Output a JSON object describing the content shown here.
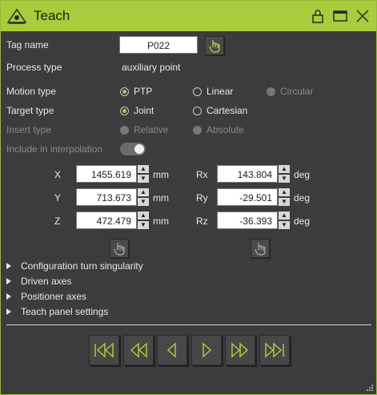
{
  "window": {
    "title": "Teach"
  },
  "fields": {
    "tag_name_label": "Tag name",
    "tag_name_value": "P022",
    "process_type_label": "Process type",
    "process_type_value": "auxiliary point",
    "motion_type_label": "Motion type",
    "motion_options": [
      "PTP",
      "Linear",
      "Circular"
    ],
    "motion_selected": "PTP",
    "target_type_label": "Target type",
    "target_options": [
      "Joint",
      "Cartesian"
    ],
    "target_selected": "Joint",
    "insert_type_label": "Insert type",
    "insert_options": [
      "Relative",
      "Absolute"
    ],
    "insert_selected": "Relative",
    "include_interp_label": "Include in interpolation",
    "include_interp_on": true
  },
  "coords": {
    "x_label": "X",
    "x_value": "1455.619",
    "x_unit": "mm",
    "y_label": "Y",
    "y_value": "713.673",
    "y_unit": "mm",
    "z_label": "Z",
    "z_value": "472.479",
    "z_unit": "mm",
    "rx_label": "Rx",
    "rx_value": "143.804",
    "rx_unit": "deg",
    "ry_label": "Ry",
    "ry_value": "-29.501",
    "ry_unit": "deg",
    "rz_label": "Rz",
    "rz_value": "-36.393",
    "rz_unit": "deg"
  },
  "sections": [
    "Configuration turn singularity",
    "Driven axes",
    "Positioner axes",
    "Teach panel settings"
  ],
  "colors": {
    "accent": "#a7cd3d",
    "background": "#3c3c3c"
  }
}
